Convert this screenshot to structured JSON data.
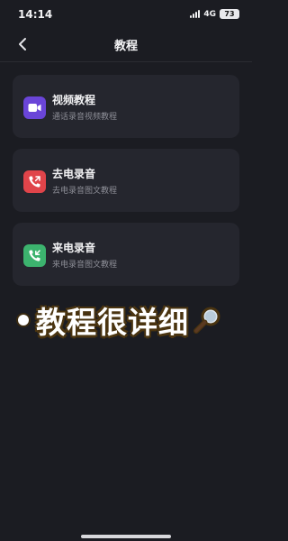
{
  "status": {
    "time": "14:14",
    "network": "4G",
    "battery": "73"
  },
  "nav": {
    "title": "教程"
  },
  "cards": [
    {
      "title": "视频教程",
      "subtitle": "通话录音视频教程",
      "icon": "video-camera-icon",
      "color": "#6a45d8"
    },
    {
      "title": "去电录音",
      "subtitle": "去电录音图文教程",
      "icon": "outgoing-call-icon",
      "color": "#e0444a"
    },
    {
      "title": "来电录音",
      "subtitle": "来电录音图文教程",
      "icon": "incoming-call-icon",
      "color": "#3cb36e"
    }
  ],
  "overlay": {
    "caption": "教程很详细"
  }
}
